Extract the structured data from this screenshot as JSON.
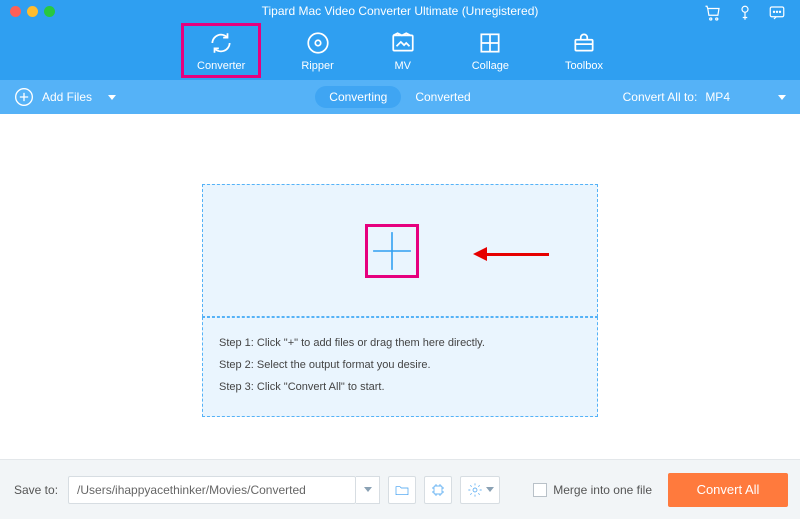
{
  "window": {
    "title": "Tipard Mac Video Converter Ultimate (Unregistered)"
  },
  "nav": {
    "tabs": [
      {
        "label": "Converter",
        "icon": "cycle-icon"
      },
      {
        "label": "Ripper",
        "icon": "disc-icon"
      },
      {
        "label": "MV",
        "icon": "image-icon"
      },
      {
        "label": "Collage",
        "icon": "grid-icon"
      },
      {
        "label": "Toolbox",
        "icon": "toolbox-icon"
      }
    ]
  },
  "subbar": {
    "add_files_label": "Add Files",
    "segments": {
      "converting": "Converting",
      "converted": "Converted"
    },
    "convert_all_to_label": "Convert All to:",
    "selected_format": "MP4"
  },
  "dropzone": {
    "steps": [
      "Step 1: Click \"+\" to add files or drag them here directly.",
      "Step 2: Select the output format you desire.",
      "Step 3: Click \"Convert All\" to start."
    ]
  },
  "bottom": {
    "save_to_label": "Save to:",
    "save_path": "/Users/ihappyacethinker/Movies/Converted",
    "merge_label": "Merge into one file",
    "convert_all_button": "Convert All"
  }
}
